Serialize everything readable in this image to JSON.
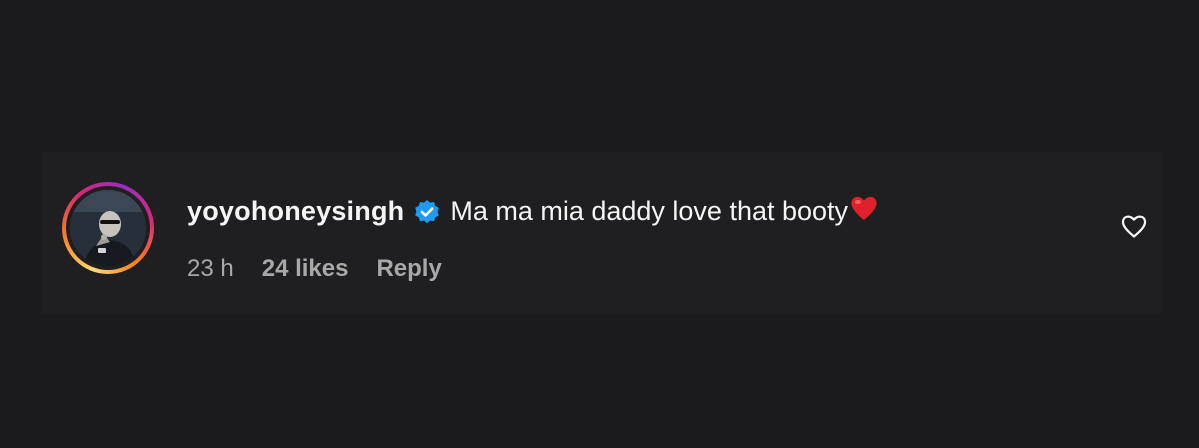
{
  "comment": {
    "username": "yoyohoneysingh",
    "verified": true,
    "text": "Ma ma mia daddy love that booty",
    "emoji": "red-heart",
    "timestamp": "23 h",
    "likes": "24 likes",
    "reply_label": "Reply",
    "like_icon": "heart-outline-icon"
  },
  "colors": {
    "background": "#1b1b1d",
    "card": "#1f1f22",
    "text_primary": "#f5f5f5",
    "text_secondary": "#a8a8a8",
    "verified_blue": "#1d9bf0",
    "heart_red": "#e0202a"
  }
}
